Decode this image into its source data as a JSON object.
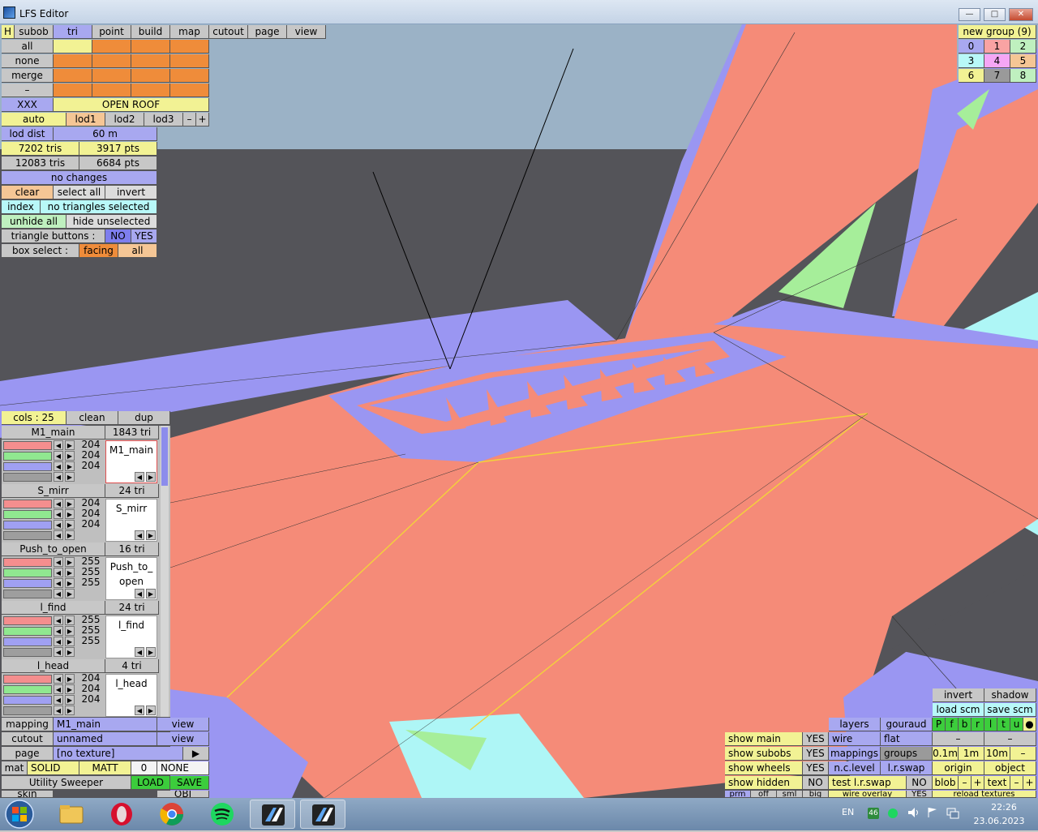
{
  "window": {
    "title": "LFS Editor",
    "minimize": "—",
    "maximize": "□",
    "close": "✕"
  },
  "menu": {
    "items": [
      "H",
      "subob",
      "tri",
      "point",
      "build",
      "map",
      "cutout",
      "page",
      "view"
    ]
  },
  "left_panel": {
    "all": "all",
    "none": "none",
    "merge": "merge",
    "dash": "–",
    "xxx": "XXX",
    "open_roof": "OPEN ROOF",
    "auto": "auto",
    "lod1": "lod1",
    "lod2": "lod2",
    "lod3": "lod3",
    "minus": "–",
    "plus": "+",
    "lod_dist_label": "lod dist",
    "lod_dist_value": "60 m",
    "tris_a": "7202 tris",
    "pts_a": "3917 pts",
    "tris_b": "12083 tris",
    "pts_b": "6684 pts",
    "changes": "no changes",
    "clear": "clear",
    "select_all": "select all",
    "invert": "invert",
    "index": "index",
    "no_tri": "no triangles selected",
    "unhide_all": "unhide all",
    "hide_unselected": "hide unselected",
    "tri_buttons": "triangle buttons :",
    "no": "NO",
    "yes": "YES",
    "box_select": "box select :",
    "facing": "facing",
    "all2": "all"
  },
  "cols_bar": {
    "cols": "cols : 25",
    "clean": "clean",
    "dup": "dup"
  },
  "objects": [
    {
      "name": "M1_main",
      "tri": "1843 tri",
      "vals": [
        "204",
        "204",
        "204"
      ],
      "preview": "M1_main"
    },
    {
      "name": "S_mirr",
      "tri": "24 tri",
      "vals": [
        "204",
        "204",
        "204"
      ],
      "preview": "S_mirr"
    },
    {
      "name": "Push_to_open",
      "tri": "16 tri",
      "vals": [
        "255",
        "255",
        "255"
      ],
      "preview": "Push_to_ open"
    },
    {
      "name": "l_find",
      "tri": "24 tri",
      "vals": [
        "255",
        "255",
        "255"
      ],
      "preview": "l_find"
    },
    {
      "name": "l_head",
      "tri": "4 tri",
      "vals": [
        "204",
        "204",
        "204"
      ],
      "preview": "l_head"
    }
  ],
  "bottom_left": {
    "mapping": "mapping",
    "mapping_val": "M1_main",
    "view1": "view",
    "cutout": "cutout",
    "cutout_val": "unnamed",
    "view2": "view",
    "page": "page",
    "page_val": "[no texture]",
    "page_arrow": "▶",
    "mat": "mat",
    "solid": "SOLID",
    "matt": "MATT",
    "zero": "0",
    "none": "NONE",
    "utility": "Utility Sweeper",
    "load": "LOAD",
    "save": "SAVE",
    "skin": "skin",
    "obj": "OBJ"
  },
  "groups": {
    "header": "new group (9)",
    "cells": [
      "0",
      "1",
      "2",
      "3",
      "4",
      "5",
      "6",
      "7",
      "8"
    ]
  },
  "right_panel": {
    "invert": "invert",
    "shadow": "shadow",
    "load_scm": "load scm",
    "save_scm": "save scm",
    "layers": "layers",
    "gouraud": "gouraud",
    "letters": [
      "P",
      "f",
      "b",
      "r",
      "l",
      "t",
      "u",
      "●"
    ],
    "show_main": "show main",
    "yes1": "YES",
    "wire": "wire",
    "flat": "flat",
    "dash1": "–",
    "dash2": "–",
    "show_subobs": "show subobs",
    "yes2": "YES",
    "mappings": "mappings",
    "groups_btn": "groups",
    "d01": "0.1m",
    "d1": "1m",
    "d10": "10m",
    "dminus": "–",
    "show_wheels": "show wheels",
    "yes3": "YES",
    "nc_level": "n.c.level",
    "lr_swap": "l.r.swap",
    "origin": "origin",
    "object": "object",
    "show_hidden": "show hidden",
    "no1": "NO",
    "test_lr": "test l.r.swap",
    "no2": "NO",
    "blob": "blob",
    "bminus": "–",
    "bplus": "+",
    "text": "text",
    "tminus": "–",
    "tplus": "+",
    "prm": "prm",
    "off": "off",
    "sml": "sml",
    "big": "big",
    "wire_overlay": "wire overlay",
    "yes4": "YES",
    "reload": "reload textures"
  },
  "taskbar": {
    "lang": "EN",
    "badge": "46",
    "time": "22:26",
    "date": "23.06.2023"
  },
  "colors": {
    "sky": "#9bb2c6",
    "ground": "#545459",
    "salmon": "#f58b78",
    "lavender": "#9a96f2",
    "green": "#a6ee9a",
    "cyan": "#aef6f6"
  }
}
